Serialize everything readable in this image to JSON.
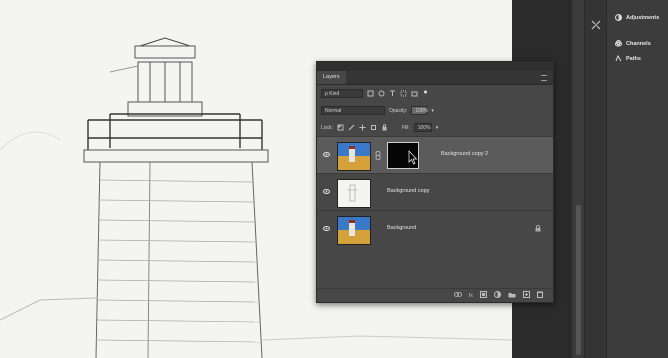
{
  "layers_panel": {
    "tab_label": "Layers",
    "kind_label": "ρ Kind",
    "blend_mode": "Normal",
    "opacity_label": "Opacity:",
    "opacity_value": "100%",
    "lock_label": "Lock:",
    "fill_label": "Fill:",
    "fill_value": "100%",
    "layers": [
      {
        "name": "Background copy 2",
        "selected": true,
        "has_mask": true
      },
      {
        "name": "Background copy",
        "selected": false,
        "has_mask": false
      },
      {
        "name": "Background",
        "selected": false,
        "has_mask": false,
        "locked": true
      }
    ],
    "bottom_icons": [
      "link-icon",
      "fx",
      "mask-icon",
      "adjustment-icon",
      "group-icon",
      "new-layer-icon",
      "trash-icon"
    ],
    "fx_label": "fx"
  },
  "side_panel": {
    "items": [
      {
        "label": "Adjustments",
        "icon": "adjustments-icon"
      },
      {
        "label": "Channels",
        "icon": "channels-icon"
      },
      {
        "label": "Paths",
        "icon": "paths-icon"
      }
    ]
  },
  "colors": {
    "panel_bg": "#474747",
    "selected_row": "#5b5b5b",
    "workspace": "#2b2b2b"
  }
}
